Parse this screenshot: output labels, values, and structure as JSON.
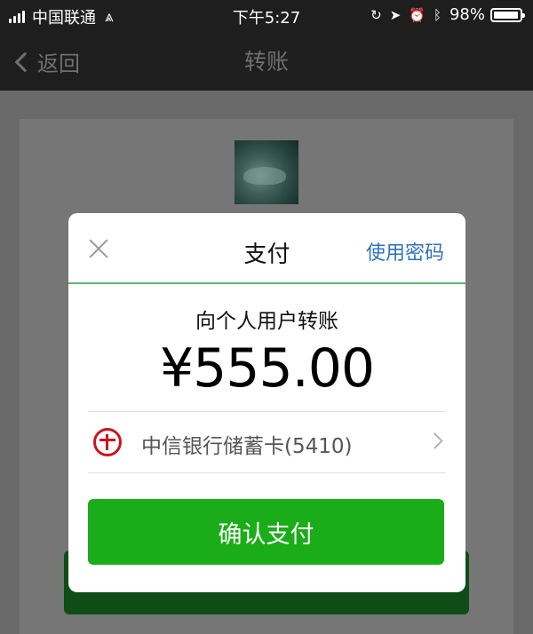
{
  "status_bar": {
    "carrier": "中国联通",
    "time": "下午5:27",
    "battery_percent": "98%",
    "battery_level": 0.98,
    "icons": [
      "signal-icon",
      "wifi-icon",
      "orientation-lock-icon",
      "location-icon",
      "alarm-icon",
      "bluetooth-icon",
      "battery-icon"
    ]
  },
  "nav": {
    "back_label": "返回",
    "title": "转账"
  },
  "background_page": {
    "avatar": "recipient-avatar"
  },
  "dialog": {
    "title": "支付",
    "password_link": "使用密码",
    "subtitle": "向个人用户转账",
    "amount": "¥555.00",
    "payment_method": "中信银行储蓄卡(5410)",
    "confirm_label": "确认支付"
  },
  "colors": {
    "accent_green": "#1aad19",
    "link_blue": "#2f73b7",
    "bank_red": "#c8161e"
  }
}
